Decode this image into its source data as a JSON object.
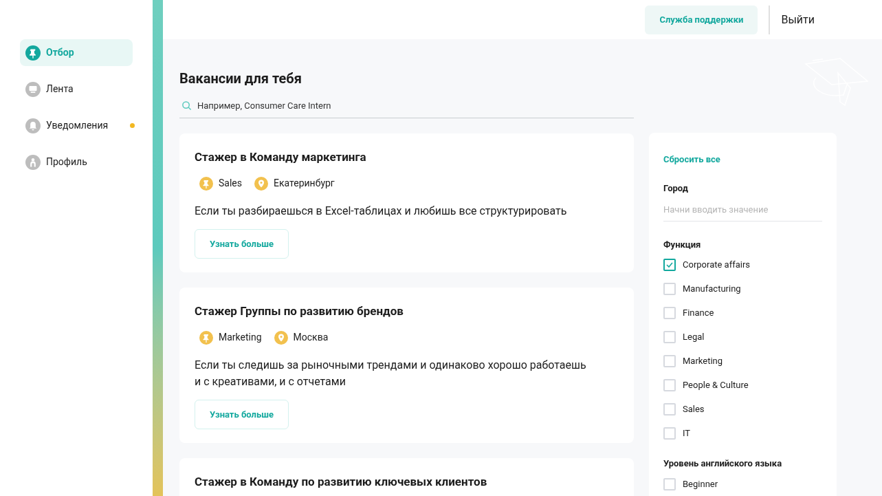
{
  "sidebar": {
    "items": [
      {
        "label": "Отбор",
        "kind": "pin",
        "selected": true,
        "badge": false
      },
      {
        "label": "Лента",
        "kind": "monitor",
        "selected": false,
        "badge": false
      },
      {
        "label": "Уведомления",
        "kind": "bell",
        "selected": false,
        "badge": true
      },
      {
        "label": "Профиль",
        "kind": "person",
        "selected": false,
        "badge": false
      }
    ]
  },
  "header": {
    "support_button": "Служба поддержки",
    "logout": "Выйти"
  },
  "title": "Вакансии для тебя",
  "search": {
    "placeholder": "Например, Consumer Care Intern"
  },
  "vacancies": [
    {
      "title": "Стажер в Команду маркетинга",
      "tags": [
        {
          "kind": "function",
          "label": "Sales"
        },
        {
          "kind": "location",
          "label": "Екатеринбург"
        }
      ],
      "description": "Если ты разбираешься в Excel-таблицах и любишь все структурировать",
      "button": "Узнать больше"
    },
    {
      "title": "Стажер Группы по развитию брендов",
      "tags": [
        {
          "kind": "function",
          "label": "Marketing"
        },
        {
          "kind": "location",
          "label": "Москва"
        }
      ],
      "description": "Если ты следишь за рыночными трендами и одинаково хорошо работаешь и с креативами, и с отчетами",
      "button": "Узнать больше"
    },
    {
      "title": "Стажер в Команду по развитию ключевых клиентов"
    }
  ],
  "filters": {
    "reset": "Сбросить все",
    "city": {
      "label": "Город",
      "placeholder": "Начни вводить значение"
    },
    "groups": [
      {
        "label": "Функция",
        "options": [
          {
            "label": "Corporate affairs",
            "checked": true
          },
          {
            "label": "Manufacturing",
            "checked": false
          },
          {
            "label": "Finance",
            "checked": false
          },
          {
            "label": "Legal",
            "checked": false
          },
          {
            "label": "Marketing",
            "checked": false
          },
          {
            "label": "People & Culture",
            "checked": false
          },
          {
            "label": "Sales",
            "checked": false
          },
          {
            "label": "IT",
            "checked": false
          }
        ]
      },
      {
        "label": "Уровень английского языка",
        "options": [
          {
            "label": "Beginner",
            "checked": false
          }
        ]
      }
    ]
  }
}
